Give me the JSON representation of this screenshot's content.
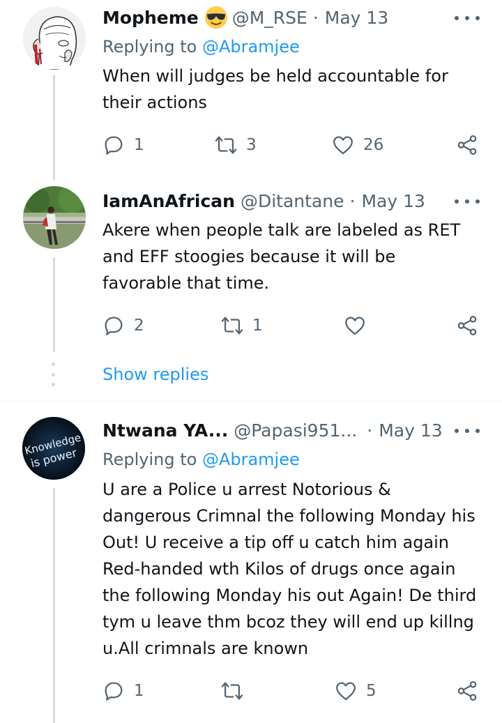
{
  "tweets": [
    {
      "name": "Mopheme",
      "emoji": "sunglasses-emoji",
      "handle": "@M_RSE",
      "date": "May 13",
      "replying_prefix": "Replying to ",
      "replying_to": "@Abramjee",
      "text": "When will judges be held accountable for their actions",
      "replies": "1",
      "retweets": "3",
      "likes": "26"
    },
    {
      "name": "IamAnAfrican",
      "handle": "@Ditantane",
      "date": "May 13",
      "text": "Akere when people talk are labeled as RET and EFF stoogies because it will be favorable that time.",
      "replies": "2",
      "retweets": "1",
      "likes": ""
    },
    {
      "name": "Ntwana YA...",
      "handle": "@Papasi951...",
      "date": "May 13",
      "replying_prefix": "Replying to ",
      "replying_to": "@Abramjee",
      "text": "U are a Police u arrest Notorious & dangerous Crimnal the following Monday his Out! U receive a tip off u catch him again  Red-handed wth Kilos of drugs once again the following Monday his out Again! De third tym u leave thm bcoz they will end up killng u.All crimnals are known",
      "avatar_text_1": "Knowledge",
      "avatar_text_2": "is power",
      "replies": "1",
      "retweets": "",
      "likes": "5"
    }
  ],
  "show_replies_label": "Show replies",
  "colors": {
    "text": "#0f1419",
    "secondary": "#536471",
    "link": "#1d9bf0",
    "thread_line": "#cfd9de"
  }
}
